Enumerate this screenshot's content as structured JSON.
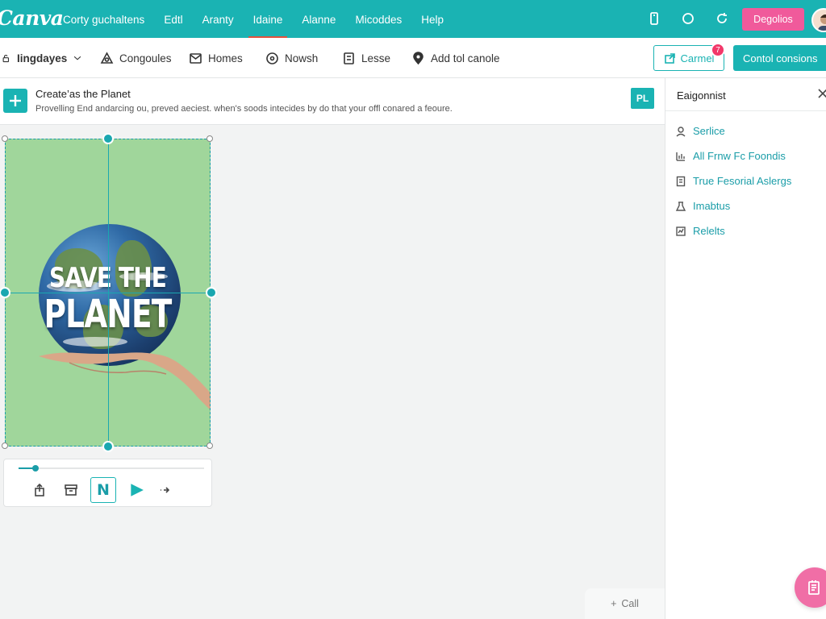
{
  "app": {
    "logo_text": "Canva"
  },
  "topnav": {
    "items": [
      {
        "label": "Corty guchaltens",
        "active": false
      },
      {
        "label": "Edtl",
        "active": false
      },
      {
        "label": "Aranty",
        "active": false
      },
      {
        "label": "Idaine",
        "active": true
      },
      {
        "label": "Alanne",
        "active": false
      },
      {
        "label": "Micoddes",
        "active": false
      },
      {
        "label": "Help",
        "active": false
      }
    ],
    "icons": [
      "phone-icon",
      "circle-icon",
      "refresh-icon"
    ],
    "cta_label": "Degolios",
    "cta_color": "#f05a9b"
  },
  "toolbar": {
    "items": [
      {
        "label": "Iingdayes",
        "icon": "chevron-down-icon"
      },
      {
        "label": "Congoules",
        "icon": "shape-icon"
      },
      {
        "label": "Homes",
        "icon": "mail-icon"
      },
      {
        "label": "Nowsh",
        "icon": "settings-icon"
      },
      {
        "label": "Lesse",
        "icon": "frame-icon"
      },
      {
        "label": "Add tol canole",
        "icon": "pin-icon"
      }
    ],
    "outline_button_label": "Carmel",
    "notification_count": "7",
    "primary_button_label": "Contol consions"
  },
  "banner": {
    "title": "Create’as the Planet",
    "description": "Provelling End andarcing ou, preved aeciest. when's soods intecides by do that your offl conared a feoure.",
    "badge": "PL"
  },
  "panel": {
    "title": "Eaigonnist",
    "items": [
      {
        "label": "Serlice",
        "icon": "user-icon"
      },
      {
        "label": "All Frnw Fc Foondis",
        "icon": "chart-icon"
      },
      {
        "label": "True Fesorial Aslergs",
        "icon": "document-icon"
      },
      {
        "label": "Imabtus",
        "icon": "flask-icon"
      },
      {
        "label": "Relelts",
        "icon": "report-icon"
      }
    ]
  },
  "canvas": {
    "background": "#a0d69b",
    "poster_line1": "SAVE THE",
    "poster_line2": "PLANET"
  },
  "media": {
    "progress": 0.09,
    "n_button": "N"
  },
  "bottom": {
    "add_label": "Call"
  },
  "colors": {
    "accent": "#1ab3b3",
    "accent_dark": "#1a9da8",
    "pink": "#f06ea6"
  }
}
